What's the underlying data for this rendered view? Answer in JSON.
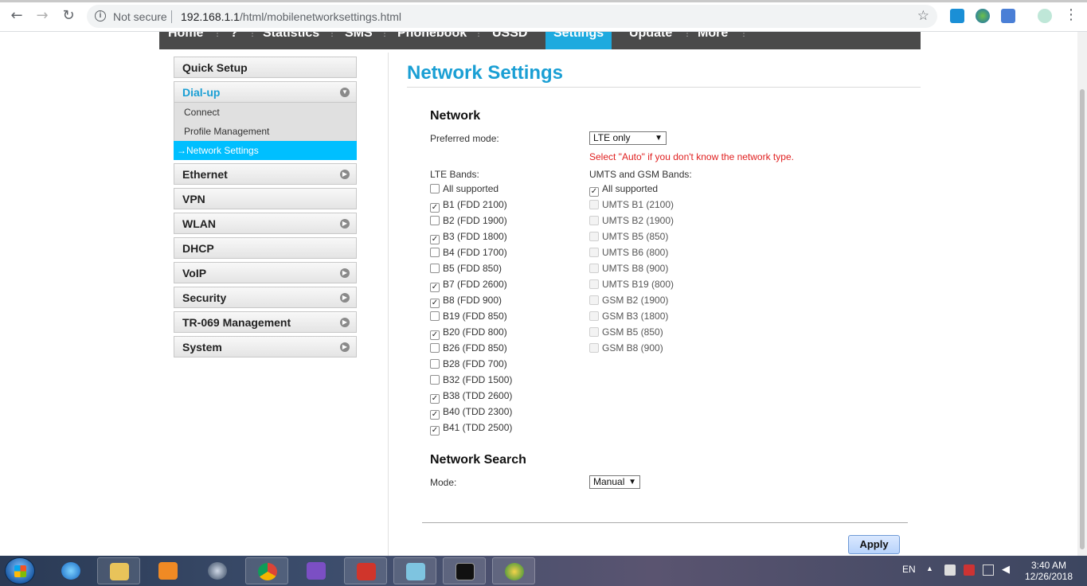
{
  "browser": {
    "security_label": "Not secure",
    "url_host": "192.168.1.1",
    "url_path": "/html/mobilenetworksettings.html"
  },
  "topnav": {
    "items": [
      "Home",
      "?",
      "Statistics",
      "SMS",
      "Phonebook",
      "USSD",
      "Settings",
      "Update",
      "More"
    ],
    "active": "Settings"
  },
  "sidebar": {
    "items": [
      {
        "label": "Quick Setup"
      },
      {
        "label": "Dial-up"
      },
      {
        "label": "Ethernet"
      },
      {
        "label": "VPN"
      },
      {
        "label": "WLAN"
      },
      {
        "label": "DHCP"
      },
      {
        "label": "VoIP"
      },
      {
        "label": "Security"
      },
      {
        "label": "TR-069 Management"
      },
      {
        "label": "System"
      }
    ],
    "dialup_sub": [
      "Connect",
      "Profile Management",
      "→Network Settings"
    ]
  },
  "page": {
    "title": "Network Settings",
    "network_heading": "Network",
    "preferred_mode_label": "Preferred mode:",
    "preferred_mode_value": "LTE only",
    "hint": "Select \"Auto\" if you don't know the network type.",
    "lte_bands_label": "LTE Bands:",
    "umts_gsm_label": "UMTS and GSM Bands:",
    "lte_bands": [
      {
        "label": "All supported",
        "checked": false
      },
      {
        "label": "B1 (FDD 2100)",
        "checked": true
      },
      {
        "label": "B2 (FDD 1900)",
        "checked": false
      },
      {
        "label": "B3 (FDD 1800)",
        "checked": true
      },
      {
        "label": "B4 (FDD 1700)",
        "checked": false
      },
      {
        "label": "B5 (FDD 850)",
        "checked": false
      },
      {
        "label": "B7 (FDD 2600)",
        "checked": true
      },
      {
        "label": "B8 (FDD 900)",
        "checked": true
      },
      {
        "label": "B19 (FDD 850)",
        "checked": false
      },
      {
        "label": "B20 (FDD 800)",
        "checked": true
      },
      {
        "label": "B26 (FDD 850)",
        "checked": false
      },
      {
        "label": "B28 (FDD 700)",
        "checked": false
      },
      {
        "label": "B32 (FDD 1500)",
        "checked": false
      },
      {
        "label": "B38 (TDD 2600)",
        "checked": true
      },
      {
        "label": "B40 (TDD 2300)",
        "checked": true
      },
      {
        "label": "B41 (TDD 2500)",
        "checked": true
      }
    ],
    "umts_gsm_bands": [
      {
        "label": "All supported",
        "checked": true
      },
      {
        "label": "UMTS B1 (2100)",
        "checked": false
      },
      {
        "label": "UMTS B2 (1900)",
        "checked": false
      },
      {
        "label": "UMTS B5 (850)",
        "checked": false
      },
      {
        "label": "UMTS B6 (800)",
        "checked": false
      },
      {
        "label": "UMTS B8 (900)",
        "checked": false
      },
      {
        "label": "UMTS B19 (800)",
        "checked": false
      },
      {
        "label": "GSM B2 (1900)",
        "checked": false
      },
      {
        "label": "GSM B3 (1800)",
        "checked": false
      },
      {
        "label": "GSM B5 (850)",
        "checked": false
      },
      {
        "label": "GSM B8 (900)",
        "checked": false
      }
    ],
    "network_search_heading": "Network Search",
    "mode_label": "Mode:",
    "mode_value": "Manual",
    "apply_label": "Apply"
  },
  "taskbar": {
    "language": "EN",
    "time": "3:40 AM",
    "date": "12/26/2018"
  },
  "icons": {
    "back": "back-arrow-icon",
    "forward": "forward-arrow-icon",
    "reload": "reload-icon",
    "info": "info-icon",
    "star": "bookmark-star-icon",
    "menu": "more-vert-icon"
  }
}
